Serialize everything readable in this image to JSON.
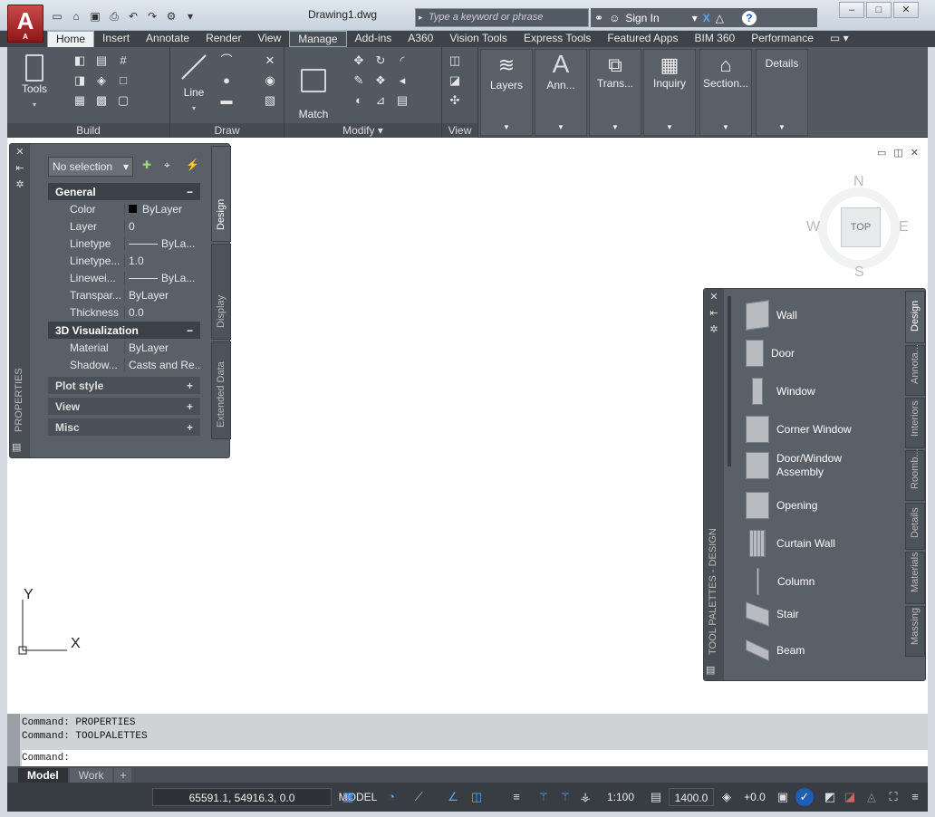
{
  "app": {
    "logo_letter": "A",
    "logo_sub": "A",
    "doc_title": "Drawing1.dwg"
  },
  "search": {
    "placeholder": "Type a keyword or phrase"
  },
  "account": {
    "signin": "Sign In"
  },
  "tabs": [
    "Home",
    "Insert",
    "Annotate",
    "Render",
    "View",
    "Manage",
    "Add-ins",
    "A360",
    "Vision Tools",
    "Express Tools",
    "Featured Apps",
    "BIM 360",
    "Performance"
  ],
  "ribbon": {
    "tools": "Tools",
    "build": "Build",
    "line": "Line",
    "draw": "Draw",
    "match_properties": "Match\nProperties",
    "modify": "Modify",
    "view": "View",
    "layers": "Layers",
    "annotation": "Ann...",
    "transparency": "Trans...",
    "inquiry": "Inquiry",
    "section": "Section...",
    "details": "Details"
  },
  "properties": {
    "palette_title": "PROPERTIES",
    "selection": "No selection",
    "tabs": [
      "Design",
      "Display",
      "Extended Data"
    ],
    "general": "General",
    "rows_general": [
      {
        "k": "Color",
        "v": "ByLayer"
      },
      {
        "k": "Layer",
        "v": "0"
      },
      {
        "k": "Linetype",
        "v": "ByLa..."
      },
      {
        "k": "Linetype...",
        "v": "1.0"
      },
      {
        "k": "Linewei...",
        "v": "ByLa..."
      },
      {
        "k": "Transpar...",
        "v": "ByLayer"
      },
      {
        "k": "Thickness",
        "v": "0.0"
      }
    ],
    "viz": "3D Visualization",
    "rows_viz": [
      {
        "k": "Material",
        "v": "ByLayer"
      },
      {
        "k": "Shadow...",
        "v": "Casts and Re..."
      }
    ],
    "collapsed": [
      "Plot style",
      "View",
      "Misc"
    ]
  },
  "viewcube": {
    "n": "N",
    "s": "S",
    "e": "E",
    "w": "W",
    "face": "TOP"
  },
  "ucs": {
    "x": "X",
    "y": "Y"
  },
  "toolpalette": {
    "title": "TOOL PALETTES - DESIGN",
    "tabs": [
      "Design",
      "Annota...",
      "Interiors",
      "Roomb...",
      "Details",
      "Materials",
      "Massing"
    ],
    "tools": [
      "Wall",
      "Door",
      "Window",
      "Corner Window",
      "Door/Window\nAssembly",
      "Opening",
      "Curtain Wall",
      "Column",
      "Stair",
      "Beam"
    ]
  },
  "command": {
    "history": [
      "Command: PROPERTIES",
      "Command: TOOLPALETTES"
    ],
    "prompt": "Command:"
  },
  "layout_tabs": [
    "Model",
    "Work",
    "+"
  ],
  "status": {
    "coords": "65591.1, 54916.3, 0.0",
    "model": "MODEL",
    "scale": "1:100",
    "cut_plane": "1400.0",
    "elevation": "+0.0"
  },
  "colors": {
    "accent": "#c22a2a",
    "ribbon": "#535961",
    "panel": "#5a6068"
  }
}
